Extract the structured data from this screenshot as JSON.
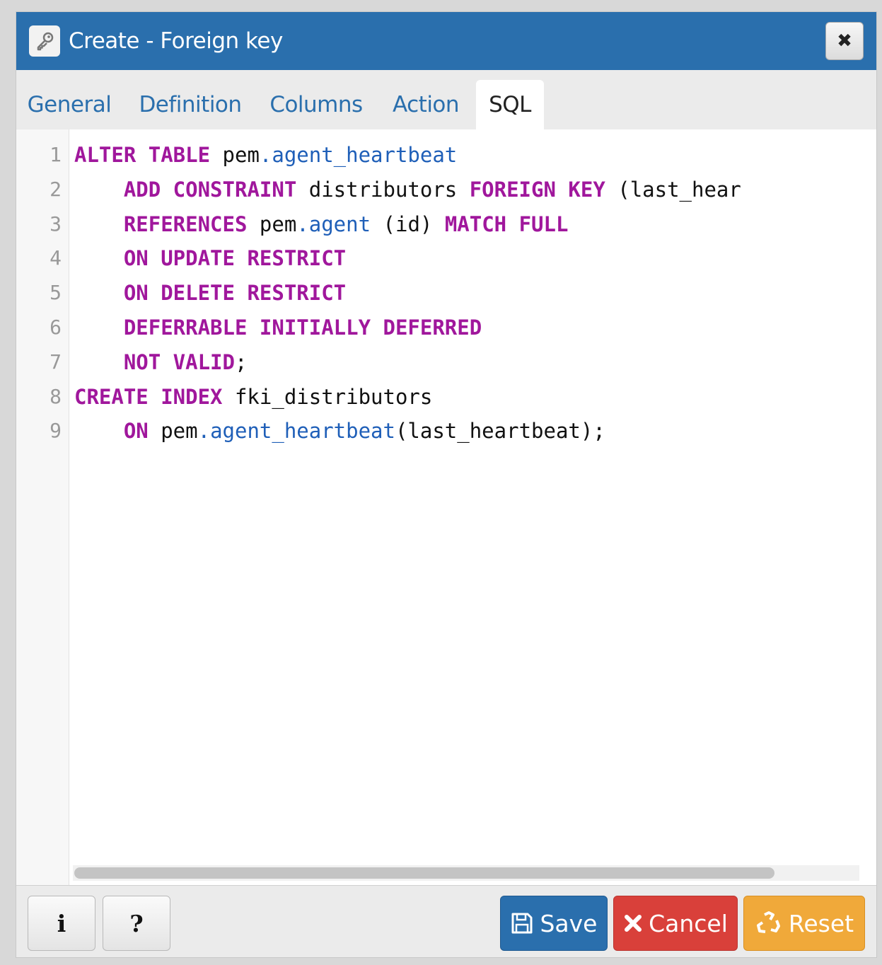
{
  "dialog": {
    "title": "Create - Foreign key",
    "title_icon": "key-icon",
    "close_icon": "close-icon",
    "close_glyph": "✖"
  },
  "tabs": [
    {
      "label": "General",
      "active": false
    },
    {
      "label": "Definition",
      "active": false
    },
    {
      "label": "Columns",
      "active": false
    },
    {
      "label": "Action",
      "active": false
    },
    {
      "label": "SQL",
      "active": true
    }
  ],
  "editor": {
    "line_numbers": [
      "1",
      "2",
      "3",
      "4",
      "5",
      "6",
      "7",
      "8",
      "9"
    ],
    "lines": [
      [
        {
          "t": "ALTER TABLE",
          "c": "kw"
        },
        {
          "t": " pem",
          "c": ""
        },
        {
          "t": ".agent_heartbeat",
          "c": "id"
        }
      ],
      [
        {
          "t": "    ",
          "c": ""
        },
        {
          "t": "ADD CONSTRAINT",
          "c": "kw"
        },
        {
          "t": " distributors ",
          "c": ""
        },
        {
          "t": "FOREIGN KEY",
          "c": "kw"
        },
        {
          "t": " (last_hear",
          "c": ""
        }
      ],
      [
        {
          "t": "    ",
          "c": ""
        },
        {
          "t": "REFERENCES",
          "c": "kw"
        },
        {
          "t": " pem",
          "c": ""
        },
        {
          "t": ".agent",
          "c": "id"
        },
        {
          "t": " (id) ",
          "c": ""
        },
        {
          "t": "MATCH FULL",
          "c": "kw"
        }
      ],
      [
        {
          "t": "    ",
          "c": ""
        },
        {
          "t": "ON UPDATE RESTRICT",
          "c": "kw"
        }
      ],
      [
        {
          "t": "    ",
          "c": ""
        },
        {
          "t": "ON DELETE RESTRICT",
          "c": "kw"
        }
      ],
      [
        {
          "t": "    ",
          "c": ""
        },
        {
          "t": "DEFERRABLE INITIALLY DEFERRED",
          "c": "kw"
        }
      ],
      [
        {
          "t": "    ",
          "c": ""
        },
        {
          "t": "NOT VALID",
          "c": "kw"
        },
        {
          "t": ";",
          "c": ""
        }
      ],
      [
        {
          "t": "CREATE INDEX",
          "c": "kw"
        },
        {
          "t": " fki_distributors",
          "c": ""
        }
      ],
      [
        {
          "t": "    ",
          "c": ""
        },
        {
          "t": "ON",
          "c": "kw"
        },
        {
          "t": " pem",
          "c": ""
        },
        {
          "t": ".agent_heartbeat",
          "c": "id"
        },
        {
          "t": "(last_heartbeat);",
          "c": ""
        }
      ]
    ]
  },
  "footer": {
    "info_label": "i",
    "help_label": "?",
    "save_label": "Save",
    "cancel_label": "Cancel",
    "reset_label": "Reset"
  },
  "colors": {
    "accent": "#2a6fad",
    "keyword": "#a0179c",
    "identifier": "#1f5fb8",
    "save": "#2a6fad",
    "cancel": "#d9403a",
    "reset": "#f0a93a"
  }
}
